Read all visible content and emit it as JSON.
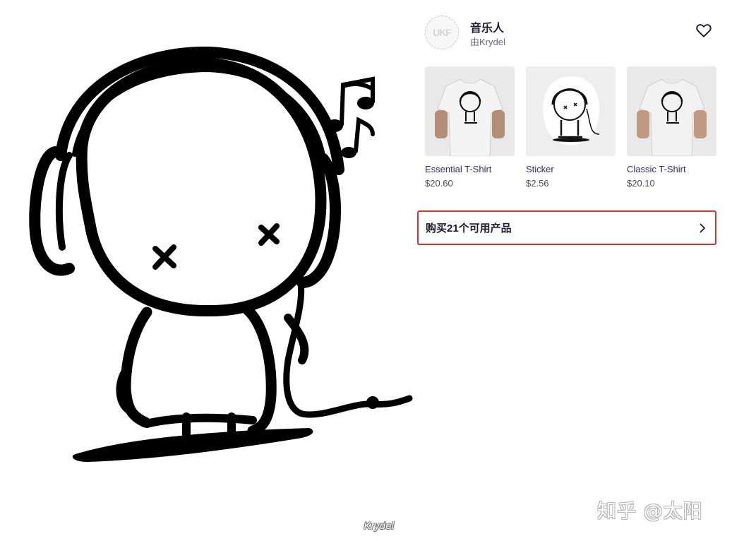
{
  "artwork": {
    "caption": "Krydel"
  },
  "header": {
    "title": "音乐人",
    "artist": "由Krydel",
    "logo_text": "UKF"
  },
  "products": [
    {
      "name": "Essential T-Shirt",
      "price": "$20.60",
      "type": "tshirt"
    },
    {
      "name": "Sticker",
      "price": "$2.56",
      "type": "sticker"
    },
    {
      "name": "Classic T-Shirt",
      "price": "$20.10",
      "type": "tshirt"
    }
  ],
  "buy_all": {
    "label": "购买21个可用产品"
  },
  "watermark": "知乎 @太阳",
  "colors": {
    "accent_border": "#d9312b",
    "product_name": "#2b2f6b",
    "muted": "#6e6a85"
  },
  "icons": {
    "favorite": "heart-outline-icon",
    "buy_all": "chevron-right-icon"
  }
}
